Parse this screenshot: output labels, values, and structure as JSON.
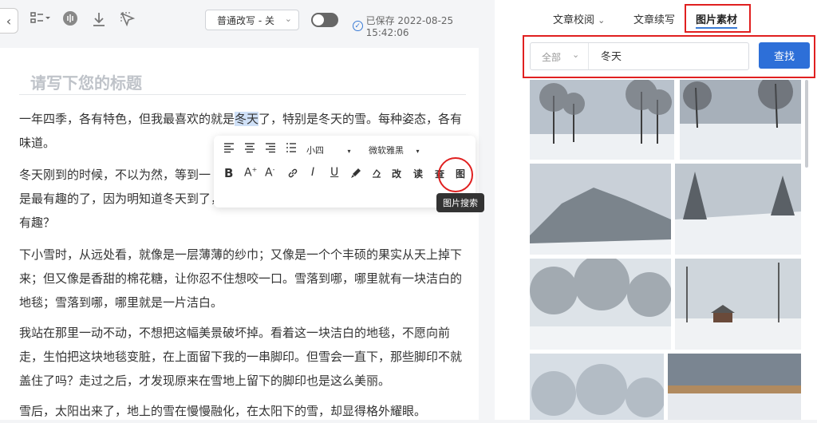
{
  "toolbar": {
    "mode_select": "普通改写 - 关",
    "saved_text": "已保存 2022-08-25 15:42:06"
  },
  "editor": {
    "title_placeholder": "请写下您的标题",
    "p1_a": "一年四季，各有特色，但我最喜欢的就是",
    "p1_hl": "冬天",
    "p1_b": "了，特别是冬天的雪。每种姿态，各有味道。",
    "p2": "冬天刚到的时候，不以为然，等到一",
    "p2_line2": "是最有趣的了，因为明知道冬天到了，还装得那么强壮，最后冷得打喷嚏，这",
    "p2_line3": "有趣？",
    "p3": "下小雪时，从远处看，就像是一层薄薄的纱巾；又像是一个个丰硕的果实从天上掉下来；但又像是香甜的棉花糖，让你忍不住想咬一口。雪落到哪，哪里就有一块洁白的地毯；雪落到哪，哪里就是一片洁白。",
    "p4": "我站在那里一动不动，不想把这幅美景破坏掉。看着这一块洁白的地毯，不愿向前走，生怕把这块地毯变脏，在上面留下我的一串脚印。但雪会一直下，那些脚印不就盖住了吗？走过之后，才发现原来在雪地上留下的脚印也是这么美丽。",
    "p5": "雪后，太阳出来了，地上的雪在慢慢融化，在太阳下的雪，却显得格外耀眼。"
  },
  "format_toolbar": {
    "font_size": "小四",
    "font_family": "微软雅黑",
    "btn_gai": "改",
    "btn_du": "读",
    "btn_cha": "查",
    "btn_tu": "图",
    "tooltip": "图片搜索"
  },
  "right_panel": {
    "tab1": "文章校阅",
    "tab2": "文章续写",
    "tab3": "图片素材",
    "category": "全部",
    "search_value": "冬天",
    "find_button": "查找"
  },
  "colors": {
    "accent": "#2d6fd8",
    "annotation_red": "#e02020",
    "highlight": "#cfe0f7"
  }
}
